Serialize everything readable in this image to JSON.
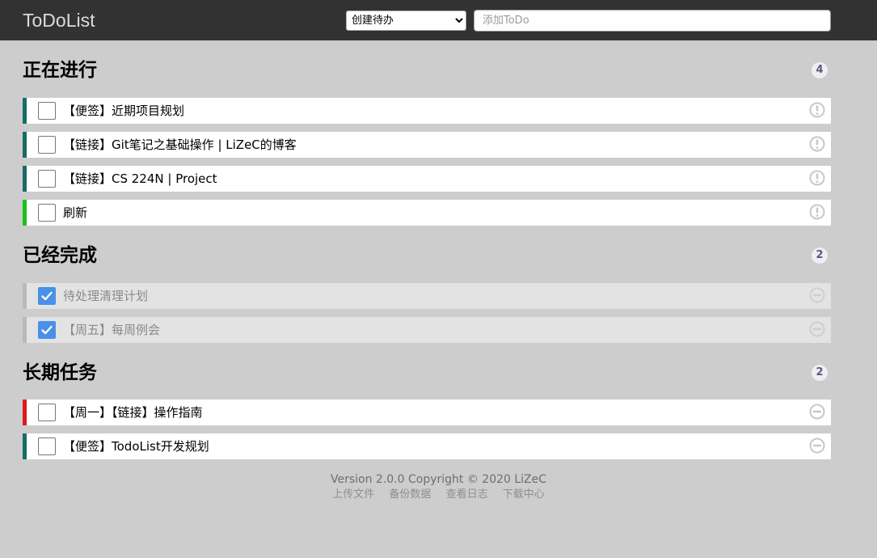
{
  "header": {
    "title": "ToDoList",
    "type_select": "创建待办",
    "add_placeholder": "添加ToDo"
  },
  "sections": {
    "in_progress": {
      "title": "正在进行",
      "count": "4",
      "items": [
        {
          "text": "【便签】近期项目规划",
          "checked": false,
          "icon": "exclamation-circle-icon"
        },
        {
          "text": "【链接】Git笔记之基础操作 | LiZeC的博客",
          "checked": false,
          "icon": "exclamation-circle-icon"
        },
        {
          "text": "【链接】CS 224N | Project",
          "checked": false,
          "icon": "exclamation-circle-icon"
        },
        {
          "text": "刷新",
          "checked": false,
          "icon": "exclamation-circle-icon"
        }
      ]
    },
    "completed": {
      "title": "已经完成",
      "count": "2",
      "items": [
        {
          "text": "待处理清理计划",
          "checked": true,
          "icon": "minus-circle-icon"
        },
        {
          "text": "【周五】每周例会",
          "checked": true,
          "icon": "minus-circle-icon"
        }
      ]
    },
    "long_term": {
      "title": "长期任务",
      "count": "2",
      "items": [
        {
          "text": "【周一】【链接】操作指南",
          "checked": false,
          "icon": "minus-circle-icon"
        },
        {
          "text": "【便签】TodoList开发规划",
          "checked": false,
          "icon": "minus-circle-icon"
        }
      ]
    }
  },
  "colors": {
    "header_bg": "#323232",
    "page_bg": "#cdcdcd",
    "border_default": "#1a6b66",
    "border_green": "#1cc01c",
    "border_red": "#dd1a1a",
    "checkbox_checked": "#4a90e8"
  },
  "footer": {
    "version": "Version 2.0.0 Copyright © 2020 LiZeC",
    "links": [
      "上传文件",
      "备份数据",
      "查看日志",
      "下载中心"
    ]
  }
}
